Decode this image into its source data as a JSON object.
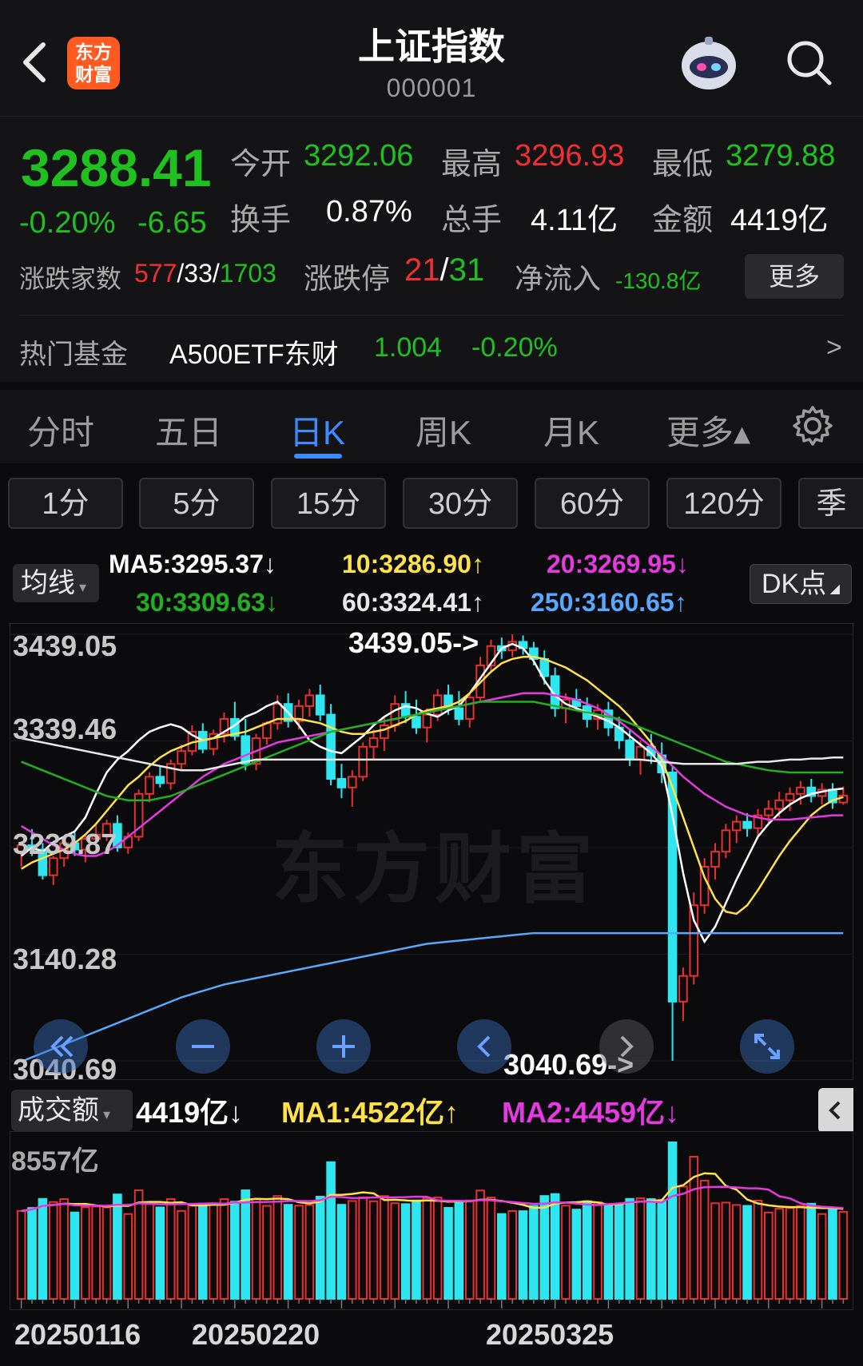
{
  "header": {
    "title": "上证指数",
    "code": "000001",
    "logo_line1": "东方",
    "logo_line2": "财富"
  },
  "quote": {
    "price": "3288.41",
    "change_pct": "-0.20%",
    "change_abs": "-6.65",
    "open_label": "今开",
    "open": "3292.06",
    "high_label": "最高",
    "high": "3296.93",
    "low_label": "最低",
    "low": "3279.88",
    "turnover_label": "换手",
    "turnover": "0.87%",
    "volume_label": "总手",
    "volume": "4.11亿",
    "amount_label": "金额",
    "amount": "4419亿",
    "breadth_label": "涨跌家数",
    "breadth_up": "577",
    "breadth_flat": "33",
    "breadth_down": "1703",
    "slash": "/",
    "limit_label": "涨跌停",
    "limit_up": "21",
    "limit_down": "31",
    "netflow_label": "净流入",
    "netflow": "-130.8亿",
    "more_label": "更多"
  },
  "fund": {
    "label": "热门基金",
    "name": "A500ETF东财",
    "price": "1.004",
    "change": "-0.20%",
    "arrow": ">"
  },
  "tabs": [
    "分时",
    "五日",
    "日K",
    "周K",
    "月K",
    "更多▴"
  ],
  "active_tab": "日K",
  "intervals": [
    "1分",
    "5分",
    "15分",
    "30分",
    "60分",
    "120分",
    "季"
  ],
  "ma": {
    "dropdown": "均线",
    "ma5": "MA5:3295.37↓",
    "ma10": "10:3286.90↑",
    "ma20": "20:3269.95↓",
    "ma30": "30:3309.63↓",
    "ma60": "60:3324.41↑",
    "ma250": "250:3160.65↑",
    "dk_button": "DK点"
  },
  "kchart": {
    "y_labels": [
      "3439.05",
      "3339.46",
      "3239.87",
      "3140.28",
      "3040.69"
    ],
    "high_annotation": "3439.05->",
    "low_annotation": "3040.69->",
    "watermark": "东方财富"
  },
  "volume": {
    "dropdown": "成交额",
    "value": "4419亿↓",
    "ma1": "MA1:4522亿↑",
    "ma2": "MA2:4459亿↓",
    "max_label": "8557亿",
    "dates": [
      "20250116",
      "20250220",
      "20250325"
    ]
  },
  "colors": {
    "up": "#f03030",
    "down": "#20c020",
    "accent": "#3c8cff",
    "candle_up": "#e83030",
    "candle_down": "#2ee6f0"
  },
  "icons": [
    "back-icon",
    "search-icon",
    "gear-icon",
    "robot-avatar-icon"
  ],
  "chart_data": {
    "type": "candlestick",
    "title": "上证指数 日K",
    "ylim": [
      3040.69,
      3439.05
    ],
    "y_ticks": [
      3040.69,
      3140.28,
      3239.87,
      3339.46,
      3439.05
    ],
    "x_tick_labels": [
      "20250116",
      "20250220",
      "20250325"
    ],
    "candles": [
      [
        3236,
        3246,
        3222,
        3242
      ],
      [
        3242,
        3257,
        3232,
        3238
      ],
      [
        3238,
        3244,
        3210,
        3214
      ],
      [
        3214,
        3232,
        3205,
        3230
      ],
      [
        3230,
        3250,
        3222,
        3244
      ],
      [
        3244,
        3254,
        3232,
        3238
      ],
      [
        3238,
        3252,
        3226,
        3248
      ],
      [
        3248,
        3262,
        3238,
        3252
      ],
      [
        3252,
        3266,
        3246,
        3262
      ],
      [
        3262,
        3270,
        3236,
        3240
      ],
      [
        3240,
        3254,
        3234,
        3250
      ],
      [
        3250,
        3294,
        3246,
        3290
      ],
      [
        3290,
        3310,
        3282,
        3306
      ],
      [
        3306,
        3316,
        3296,
        3300
      ],
      [
        3300,
        3322,
        3294,
        3318
      ],
      [
        3318,
        3336,
        3312,
        3330
      ],
      [
        3330,
        3354,
        3326,
        3348
      ],
      [
        3348,
        3356,
        3328,
        3332
      ],
      [
        3332,
        3350,
        3326,
        3346
      ],
      [
        3346,
        3366,
        3338,
        3360
      ],
      [
        3360,
        3376,
        3340,
        3344
      ],
      [
        3344,
        3360,
        3312,
        3318
      ],
      [
        3318,
        3346,
        3312,
        3342
      ],
      [
        3342,
        3358,
        3336,
        3356
      ],
      [
        3356,
        3382,
        3350,
        3374
      ],
      [
        3374,
        3384,
        3352,
        3358
      ],
      [
        3358,
        3378,
        3350,
        3372
      ],
      [
        3372,
        3388,
        3362,
        3382
      ],
      [
        3382,
        3392,
        3358,
        3364
      ],
      [
        3364,
        3374,
        3298,
        3304
      ],
      [
        3304,
        3318,
        3286,
        3296
      ],
      [
        3296,
        3312,
        3278,
        3306
      ],
      [
        3306,
        3338,
        3302,
        3334
      ],
      [
        3334,
        3350,
        3322,
        3342
      ],
      [
        3342,
        3362,
        3330,
        3354
      ],
      [
        3354,
        3382,
        3348,
        3374
      ],
      [
        3374,
        3386,
        3356,
        3362
      ],
      [
        3362,
        3378,
        3346,
        3352
      ],
      [
        3352,
        3370,
        3338,
        3364
      ],
      [
        3364,
        3388,
        3358,
        3382
      ],
      [
        3382,
        3392,
        3364,
        3370
      ],
      [
        3370,
        3386,
        3354,
        3360
      ],
      [
        3360,
        3384,
        3352,
        3380
      ],
      [
        3380,
        3418,
        3376,
        3410
      ],
      [
        3410,
        3434,
        3404,
        3428
      ],
      [
        3428,
        3436,
        3416,
        3424
      ],
      [
        3424,
        3439.05,
        3418,
        3432
      ],
      [
        3432,
        3438,
        3420,
        3426
      ],
      [
        3426,
        3432,
        3410,
        3416
      ],
      [
        3416,
        3424,
        3392,
        3400
      ],
      [
        3400,
        3408,
        3362,
        3370
      ],
      [
        3370,
        3384,
        3356,
        3378
      ],
      [
        3378,
        3388,
        3368,
        3372
      ],
      [
        3372,
        3380,
        3352,
        3360
      ],
      [
        3360,
        3374,
        3350,
        3368
      ],
      [
        3368,
        3376,
        3344,
        3352
      ],
      [
        3352,
        3362,
        3332,
        3340
      ],
      [
        3340,
        3350,
        3316,
        3322
      ],
      [
        3322,
        3340,
        3308,
        3334
      ],
      [
        3334,
        3346,
        3318,
        3326
      ],
      [
        3326,
        3338,
        3300,
        3310
      ],
      [
        3310,
        3316,
        3040.69,
        3096
      ],
      [
        3096,
        3128,
        3078,
        3120
      ],
      [
        3120,
        3198,
        3112,
        3186
      ],
      [
        3186,
        3230,
        3178,
        3222
      ],
      [
        3222,
        3244,
        3210,
        3236
      ],
      [
        3236,
        3262,
        3230,
        3256
      ],
      [
        3256,
        3270,
        3244,
        3264
      ],
      [
        3264,
        3272,
        3250,
        3258
      ],
      [
        3258,
        3276,
        3250,
        3270
      ],
      [
        3270,
        3284,
        3262,
        3276
      ],
      [
        3276,
        3292,
        3268,
        3284
      ],
      [
        3284,
        3296,
        3274,
        3290
      ],
      [
        3290,
        3302,
        3280,
        3296
      ],
      [
        3296,
        3304,
        3282,
        3288
      ],
      [
        3288,
        3300,
        3280,
        3294
      ],
      [
        3294,
        3300,
        3276,
        3282
      ],
      [
        3282,
        3296.93,
        3279.88,
        3288.41
      ]
    ],
    "series": [
      {
        "name": "MA5",
        "color": "#ffffff",
        "values": [
          3232,
          3240,
          3236,
          3245,
          3250,
          3255,
          3268,
          3290,
          3310,
          3322,
          3330,
          3340,
          3348,
          3352,
          3355,
          3352,
          3345,
          3340,
          3342,
          3348,
          3354,
          3362,
          3366,
          3372,
          3376,
          3366,
          3354,
          3340,
          3334,
          3330,
          3328,
          3336,
          3344,
          3354,
          3362,
          3368,
          3372,
          3370,
          3365,
          3362,
          3368,
          3372,
          3384,
          3398,
          3412,
          3426,
          3430,
          3426,
          3414,
          3396,
          3382,
          3374,
          3370,
          3366,
          3362,
          3358,
          3352,
          3344,
          3336,
          3328,
          3316,
          3270,
          3216,
          3172,
          3152,
          3166,
          3188,
          3210,
          3230,
          3250,
          3262,
          3272,
          3280,
          3286,
          3290,
          3292,
          3294,
          3295
        ]
      },
      {
        "name": "10",
        "color": "#ffe14a",
        "values": [
          3220,
          3226,
          3230,
          3234,
          3238,
          3244,
          3252,
          3262,
          3274,
          3286,
          3298,
          3306,
          3316,
          3324,
          3330,
          3334,
          3338,
          3340,
          3342,
          3344,
          3346,
          3348,
          3352,
          3356,
          3360,
          3360,
          3360,
          3358,
          3356,
          3352,
          3348,
          3346,
          3346,
          3348,
          3350,
          3354,
          3358,
          3364,
          3368,
          3370,
          3372,
          3376,
          3384,
          3394,
          3404,
          3412,
          3416,
          3418,
          3418,
          3416,
          3412,
          3408,
          3402,
          3396,
          3388,
          3380,
          3372,
          3362,
          3350,
          3338,
          3322,
          3296,
          3268,
          3240,
          3212,
          3192,
          3180,
          3178,
          3186,
          3200,
          3216,
          3232,
          3246,
          3258,
          3270,
          3278,
          3284,
          3287
        ]
      },
      {
        "name": "20",
        "color": "#e43ae0",
        "values": [
          3260,
          3254,
          3248,
          3242,
          3238,
          3234,
          3232,
          3232,
          3236,
          3242,
          3250,
          3258,
          3266,
          3274,
          3282,
          3290,
          3298,
          3306,
          3312,
          3318,
          3322,
          3326,
          3330,
          3334,
          3338,
          3340,
          3342,
          3344,
          3346,
          3348,
          3350,
          3352,
          3354,
          3356,
          3358,
          3360,
          3362,
          3364,
          3366,
          3368,
          3370,
          3372,
          3374,
          3376,
          3378,
          3380,
          3382,
          3384,
          3384,
          3384,
          3382,
          3380,
          3378,
          3374,
          3370,
          3364,
          3358,
          3350,
          3342,
          3334,
          3326,
          3316,
          3306,
          3298,
          3290,
          3284,
          3278,
          3274,
          3270,
          3268,
          3266,
          3266,
          3266,
          3267,
          3268,
          3269,
          3270,
          3270
        ]
      },
      {
        "name": "30",
        "color": "#22b022",
        "values": [
          3320,
          3316,
          3312,
          3308,
          3304,
          3300,
          3296,
          3292,
          3288,
          3286,
          3284,
          3284,
          3284,
          3286,
          3288,
          3292,
          3296,
          3300,
          3304,
          3308,
          3312,
          3316,
          3320,
          3324,
          3328,
          3332,
          3336,
          3340,
          3344,
          3348,
          3350,
          3352,
          3354,
          3356,
          3358,
          3360,
          3362,
          3364,
          3366,
          3368,
          3370,
          3372,
          3374,
          3376,
          3376,
          3376,
          3376,
          3376,
          3376,
          3374,
          3372,
          3370,
          3368,
          3366,
          3364,
          3362,
          3360,
          3356,
          3352,
          3348,
          3344,
          3340,
          3336,
          3332,
          3328,
          3324,
          3320,
          3318,
          3316,
          3314,
          3312,
          3311,
          3310,
          3310,
          3310,
          3310,
          3310,
          3310
        ]
      },
      {
        "name": "60",
        "color": "#e8e8e8",
        "values": [
          3342,
          3340,
          3338,
          3336,
          3334,
          3332,
          3330,
          3328,
          3326,
          3324,
          3322,
          3320,
          3318,
          3316,
          3314,
          3312,
          3312,
          3312,
          3314,
          3316,
          3318,
          3320,
          3322,
          3322,
          3322,
          3322,
          3322,
          3322,
          3322,
          3322,
          3322,
          3322,
          3322,
          3322,
          3322,
          3322,
          3322,
          3322,
          3322,
          3322,
          3322,
          3322,
          3322,
          3322,
          3322,
          3322,
          3322,
          3322,
          3322,
          3322,
          3322,
          3322,
          3322,
          3322,
          3322,
          3322,
          3322,
          3322,
          3322,
          3321,
          3320,
          3319,
          3318,
          3318,
          3318,
          3318,
          3318,
          3318,
          3319,
          3320,
          3320,
          3321,
          3322,
          3322,
          3323,
          3323,
          3324,
          3324
        ]
      },
      {
        "name": "250",
        "color": "#58a8ff",
        "values": [
          3040,
          3044,
          3048,
          3052,
          3056,
          3060,
          3064,
          3068,
          3072,
          3076,
          3080,
          3084,
          3088,
          3092,
          3096,
          3100,
          3103,
          3106,
          3109,
          3112,
          3114,
          3116,
          3118,
          3120,
          3122,
          3124,
          3126,
          3128,
          3130,
          3132,
          3134,
          3136,
          3138,
          3140,
          3142,
          3144,
          3146,
          3148,
          3150,
          3151,
          3152,
          3153,
          3154,
          3155,
          3156,
          3157,
          3158,
          3159,
          3160,
          3160,
          3160,
          3160,
          3160,
          3160,
          3160,
          3160,
          3160,
          3160,
          3160,
          3160,
          3160,
          3160,
          3160,
          3160,
          3160,
          3160,
          3160,
          3160,
          3160,
          3160,
          3160,
          3160,
          3160,
          3160,
          3160,
          3160,
          3160,
          3160
        ]
      }
    ],
    "volume_ylim": [
      0,
      8557
    ],
    "volume_unit": "亿"
  }
}
